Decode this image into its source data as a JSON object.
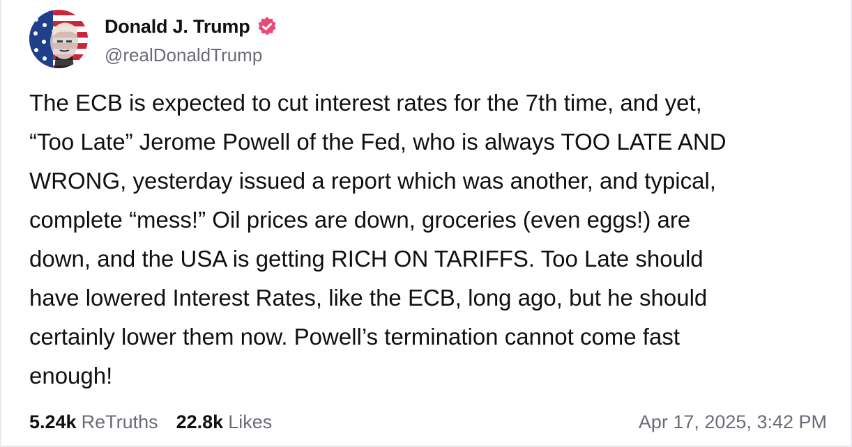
{
  "post": {
    "author": {
      "display_name": "Donald J. Trump",
      "handle": "@realDonaldTrump",
      "verified_icon": "verified-badge-icon",
      "avatar_icon": "avatar-flag-portrait"
    },
    "text": "The ECB is expected to cut interest rates for the 7th time, and yet,\n“Too Late” Jerome Powell of the Fed, who is always TOO LATE AND\nWRONG, yesterday issued a report which was another, and typical,\ncomplete “mess!” Oil prices are down, groceries (even eggs!) are\ndown, and the USA is getting RICH ON TARIFFS. Too Late should\nhave lowered Interest Rates, like the ECB, long ago, but he should\ncertainly lower them now. Powell’s termination cannot come fast\nenough!",
    "stats": {
      "retruths_count": "5.24k",
      "retruths_label": "ReTruths",
      "likes_count": "22.8k",
      "likes_label": "Likes"
    },
    "timestamp": "Apr 17, 2025, 3:42 PM"
  },
  "colors": {
    "verified": "#e94b76",
    "text": "#0f0f14",
    "muted": "#6b6b78",
    "border": "#e9e9ee"
  }
}
